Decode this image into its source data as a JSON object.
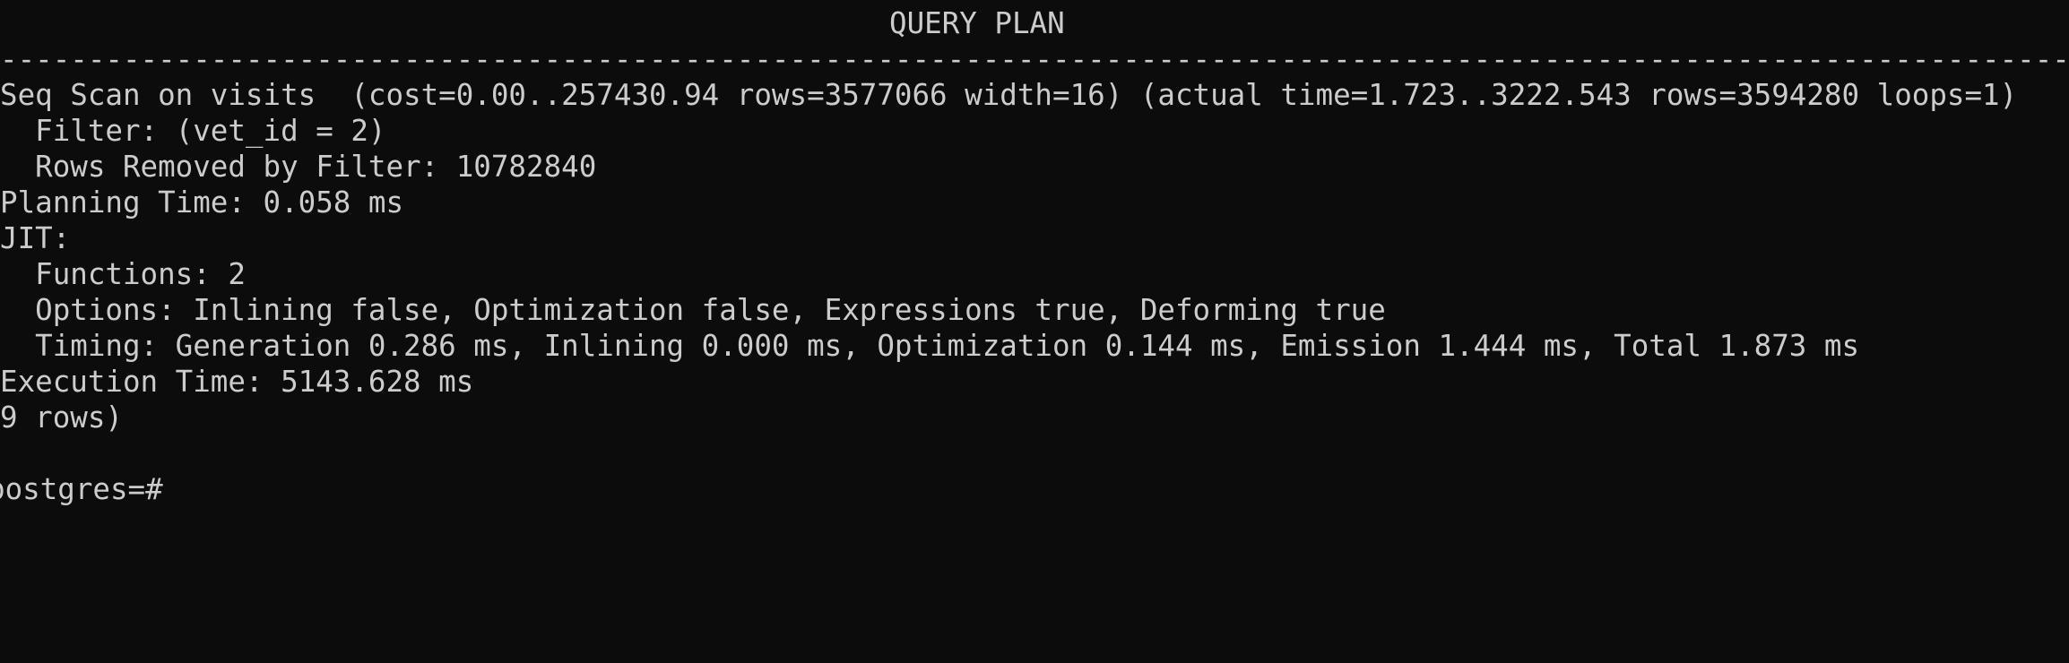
{
  "terminal": {
    "background": "#0c0c0c",
    "foreground": "#cccccc",
    "header": "QUERY PLAN",
    "separator": "-------------------------------------------------------------------------------------------------------------------------------",
    "lines": [
      "Seq Scan on visits  (cost=0.00..257430.94 rows=3577066 width=16) (actual time=1.723..3222.543 rows=3594280 loops=1)",
      "  Filter: (vet_id = 2)",
      "  Rows Removed by Filter: 10782840",
      "Planning Time: 0.058 ms",
      "JIT:",
      "  Functions: 2",
      "  Options: Inlining false, Optimization false, Expressions true, Deforming true",
      "  Timing: Generation 0.286 ms, Inlining 0.000 ms, Optimization 0.144 ms, Emission 1.444 ms, Total 1.873 ms",
      "Execution Time: 5143.628 ms"
    ],
    "row_count": "9 rows)",
    "prompt": "postgres=#"
  }
}
